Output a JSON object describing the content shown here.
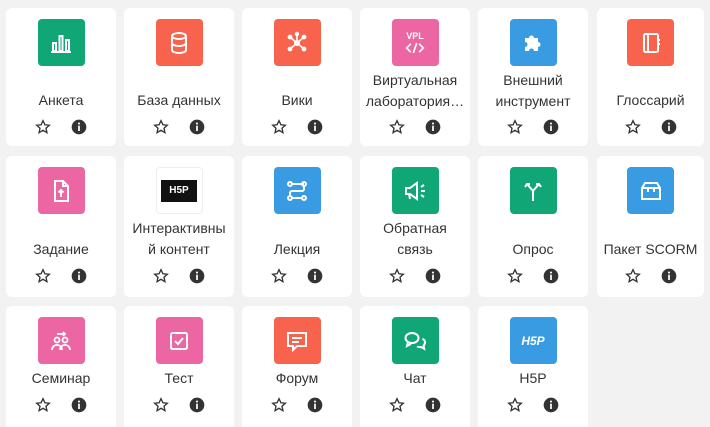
{
  "modules": [
    {
      "name": "Анкета",
      "icon": "bar-chart-icon",
      "color": "#11a676"
    },
    {
      "name": "База данных",
      "icon": "database-icon",
      "color": "#f7634d"
    },
    {
      "name": "Вики",
      "icon": "wiki-icon",
      "color": "#f7634d"
    },
    {
      "name": "Виртуальная лаборатория…",
      "name_line1": "Виртуальная",
      "name_line2": "лаборатория…",
      "icon": "vpl-icon",
      "color": "#eb66a2"
    },
    {
      "name": "Внешний инструмент",
      "name_line1": "Внешний",
      "name_line2": "инструмент",
      "icon": "puzzle-icon",
      "color": "#399be2"
    },
    {
      "name": "Глоссарий",
      "icon": "glossary-icon",
      "color": "#f7634d"
    },
    {
      "name": "Задание",
      "icon": "assignment-icon",
      "color": "#eb66a2"
    },
    {
      "name": "Интерактивный контент",
      "name_line1": "Интерактивны",
      "name_line2": "й контент",
      "icon": "h5p-black-icon",
      "color": "#111111"
    },
    {
      "name": "Лекция",
      "icon": "lesson-icon",
      "color": "#399be2"
    },
    {
      "name": "Обратная связь",
      "name_line1": "Обратная",
      "name_line2": "связь",
      "icon": "feedback-icon",
      "color": "#11a676"
    },
    {
      "name": "Опрос",
      "icon": "choice-icon",
      "color": "#11a676"
    },
    {
      "name": "Пакет SCORM",
      "icon": "scorm-icon",
      "color": "#399be2"
    },
    {
      "name": "Семинар",
      "icon": "workshop-icon",
      "color": "#eb66a2"
    },
    {
      "name": "Тест",
      "icon": "quiz-icon",
      "color": "#eb66a2"
    },
    {
      "name": "Форум",
      "icon": "forum-icon",
      "color": "#f7634d"
    },
    {
      "name": "Чат",
      "icon": "chat-icon",
      "color": "#11a676"
    },
    {
      "name": "H5P",
      "icon": "h5p-icon",
      "color": "#399be2"
    }
  ],
  "labels": {
    "vpl": "VPL",
    "h5p": "H5P"
  }
}
